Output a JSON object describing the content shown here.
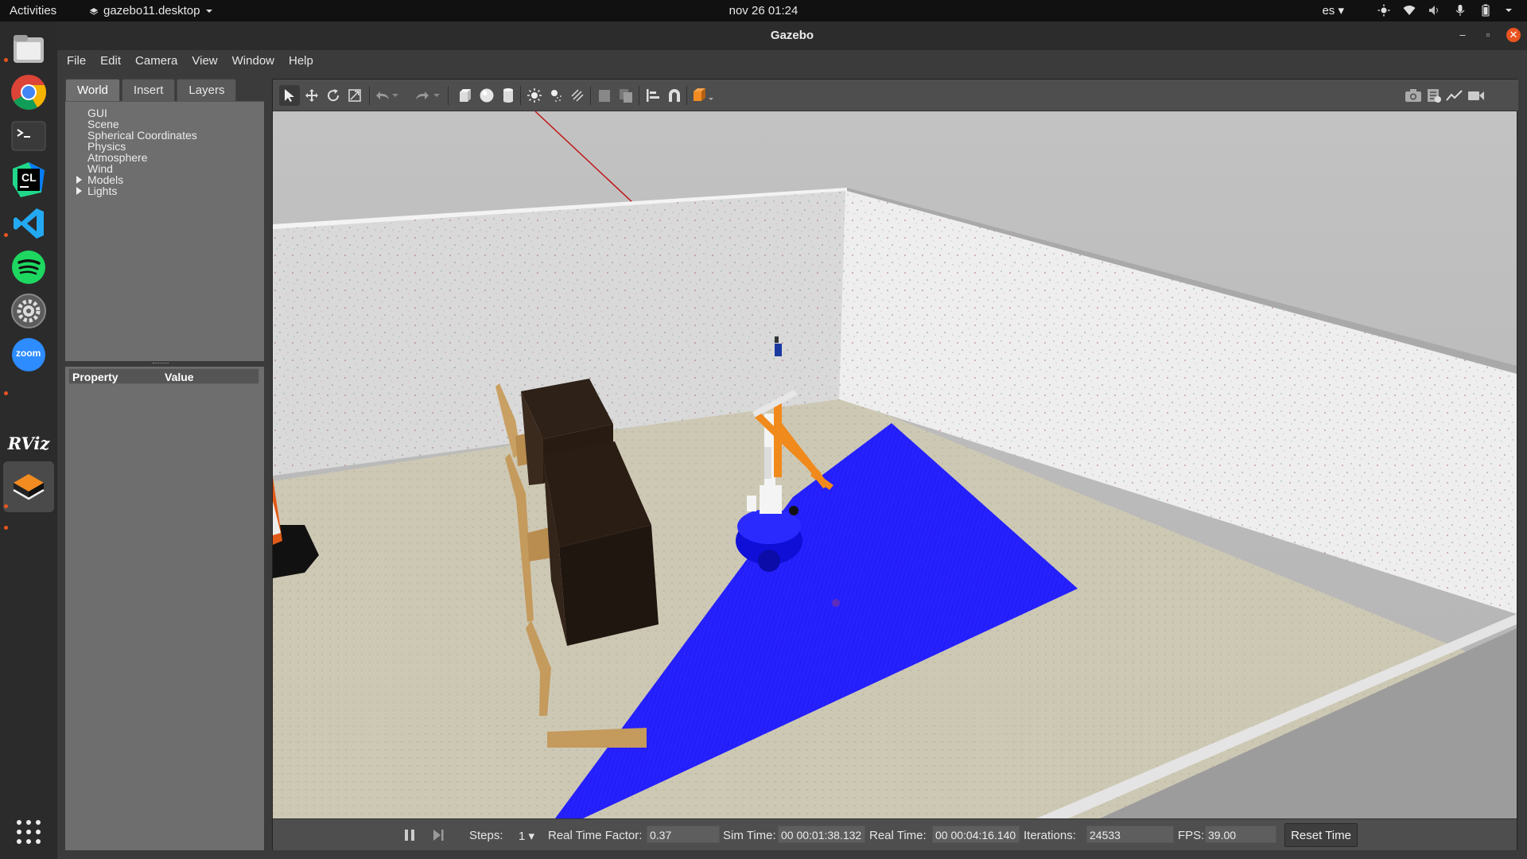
{
  "topbar": {
    "activities": "Activities",
    "app_menu": "gazebo11.desktop",
    "clock": "nov 26  01:24",
    "language": "es"
  },
  "dock": {
    "items": [
      {
        "name": "files",
        "icon": "files-icon"
      },
      {
        "name": "chrome",
        "icon": "chrome-icon"
      },
      {
        "name": "terminal",
        "icon": "terminal-icon"
      },
      {
        "name": "clion",
        "icon": "clion-icon",
        "label": "CL"
      },
      {
        "name": "vscode",
        "icon": "vscode-icon"
      },
      {
        "name": "spotify",
        "icon": "spotify-icon"
      },
      {
        "name": "settings",
        "icon": "settings-icon"
      },
      {
        "name": "zoom",
        "icon": "zoom-icon",
        "label": "zoom"
      },
      {
        "name": "rviz",
        "icon": "rviz-icon",
        "label": "RViz"
      },
      {
        "name": "gazebo",
        "icon": "gazebo-icon"
      },
      {
        "name": "show-apps",
        "icon": "app-grid-icon"
      }
    ]
  },
  "window": {
    "title": "Gazebo",
    "menu": [
      "File",
      "Edit",
      "Camera",
      "View",
      "Window",
      "Help"
    ]
  },
  "left_panel": {
    "tabs": [
      "World",
      "Insert",
      "Layers"
    ],
    "active_tab": "World",
    "tree": [
      "GUI",
      "Scene",
      "Spherical Coordinates",
      "Physics",
      "Atmosphere",
      "Wind",
      "Models",
      "Lights"
    ],
    "properties_header": {
      "property": "Property",
      "value": "Value"
    }
  },
  "toolbar": {
    "icons": [
      "select-arrow-icon",
      "translate-icon",
      "rotate-icon",
      "scale-icon",
      "undo-icon",
      "redo-icon",
      "box-icon",
      "sphere-icon",
      "cylinder-icon",
      "point-light-icon",
      "spot-light-icon",
      "directional-light-icon",
      "copy-icon",
      "paste-icon",
      "align-icon",
      "snap-icon",
      "view-angle-icon",
      "screenshot-icon",
      "log-icon",
      "plot-icon",
      "record-video-icon"
    ]
  },
  "bottom_bar": {
    "steps_label": "Steps:",
    "steps_value": "1",
    "rtf_label": "Real Time Factor:",
    "rtf_value": "0.37",
    "sim_time_label": "Sim Time:",
    "sim_time_value": "00 00:01:38.132",
    "real_time_label": "Real Time:",
    "real_time_value": "00 00:04:16.140",
    "iterations_label": "Iterations:",
    "iterations_value": "24533",
    "fps_label": "FPS:",
    "fps_value": "39.00",
    "reset_label": "Reset Time"
  },
  "colors": {
    "accent": "#e95420",
    "laser": "#2222ff",
    "robot_arm": "#f08a1c"
  }
}
